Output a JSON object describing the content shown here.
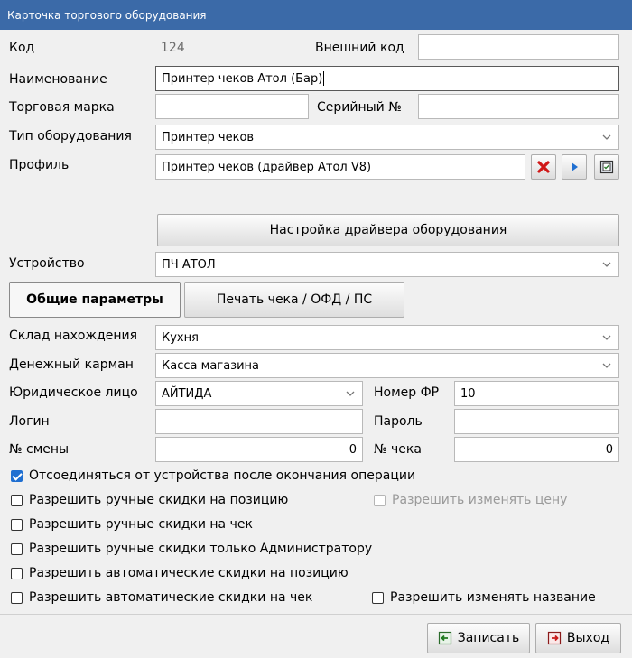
{
  "window": {
    "title": "Карточка торгового оборудования"
  },
  "fields": {
    "code_label": "Код",
    "code_value": "124",
    "external_code_label": "Внешний код",
    "external_code_value": "",
    "name_label": "Наименование",
    "name_value": "Принтер чеков Атол (Бар)",
    "brand_label": "Торговая марка",
    "brand_value": "",
    "serial_label": "Серийный №",
    "serial_value": "",
    "type_label": "Тип оборудования",
    "type_value": "Принтер чеков",
    "profile_label": "Профиль",
    "profile_value": "Принтер чеков (драйвер Атол V8)",
    "driver_settings_label": "Настройка драйвера оборудования",
    "device_label": "Устройство",
    "device_value": "ПЧ АТОЛ"
  },
  "tabs": [
    {
      "label": "Общие параметры",
      "active": true
    },
    {
      "label": "Печать чека / ОФД / ПС",
      "active": false
    }
  ],
  "general": {
    "warehouse_label": "Склад нахождения",
    "warehouse_value": "Кухня",
    "cash_label": "Денежный карман",
    "cash_value": "Касса магазина",
    "legal_label": "Юридическое лицо",
    "legal_value": "АЙТИДА",
    "fr_number_label": "Номер ФР",
    "fr_number_value": "10",
    "login_label": "Логин",
    "login_value": "",
    "password_label": "Пароль",
    "password_value": "",
    "shift_label": "№ смены",
    "shift_value": "0",
    "check_label": "№ чека",
    "check_value": "0"
  },
  "checkboxes": {
    "disconnect": {
      "label": "Отсоединяться от устройства после окончания операции",
      "checked": true
    },
    "manual_pos": {
      "label": "Разрешить ручные скидки на позицию",
      "checked": false
    },
    "change_price": {
      "label": "Разрешить изменять цену",
      "checked": false,
      "disabled": true
    },
    "manual_check": {
      "label": "Разрешить ручные скидки на чек",
      "checked": false
    },
    "manual_admin": {
      "label": "Разрешить ручные скидки только Администратору",
      "checked": false
    },
    "auto_pos": {
      "label": "Разрешить автоматические скидки на позицию",
      "checked": false
    },
    "auto_check": {
      "label": "Разрешить автоматические скидки на чек",
      "checked": false
    },
    "change_name": {
      "label": "Разрешить изменять название",
      "checked": false
    }
  },
  "footer": {
    "save_label": "Записать",
    "exit_label": "Выход"
  },
  "colors": {
    "title_bar": "#3b6aa8",
    "accent": "#1f6fd1",
    "delete_red": "#d01818"
  }
}
